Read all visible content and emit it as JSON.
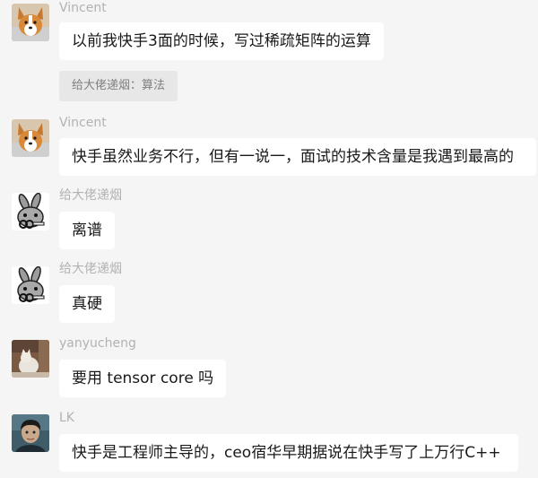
{
  "messages": [
    {
      "name": "Vincent",
      "avatar_icon": "corgi-avatar-icon",
      "text": "以前我快手3面的时候，写过稀疏矩阵的运算",
      "quote": "给大佬递烟：算法"
    },
    {
      "name": "Vincent",
      "avatar_icon": "corgi-avatar-icon",
      "text": "快手虽然业务不行，但有一说一，面试的技术含量是我遇到最高的"
    },
    {
      "name": "给大佬递烟",
      "avatar_icon": "rabbit-avatar-icon",
      "text": "离谱"
    },
    {
      "name": "给大佬递烟",
      "avatar_icon": "rabbit-avatar-icon",
      "text": "真硬"
    },
    {
      "name": "yanyucheng",
      "avatar_icon": "cat-photo-avatar-icon",
      "text": "要用 tensor core 吗"
    },
    {
      "name": "LK",
      "avatar_icon": "person-avatar-icon",
      "text": "快手是工程师主导的，ceo宿华早期据说在快手写了上万行C++"
    }
  ],
  "colors": {
    "background": "#f5f5f5",
    "bubble": "#ffffff",
    "quote_bg": "#e7e7e7",
    "name_text": "#b2b2b2",
    "message_text": "#191919"
  }
}
